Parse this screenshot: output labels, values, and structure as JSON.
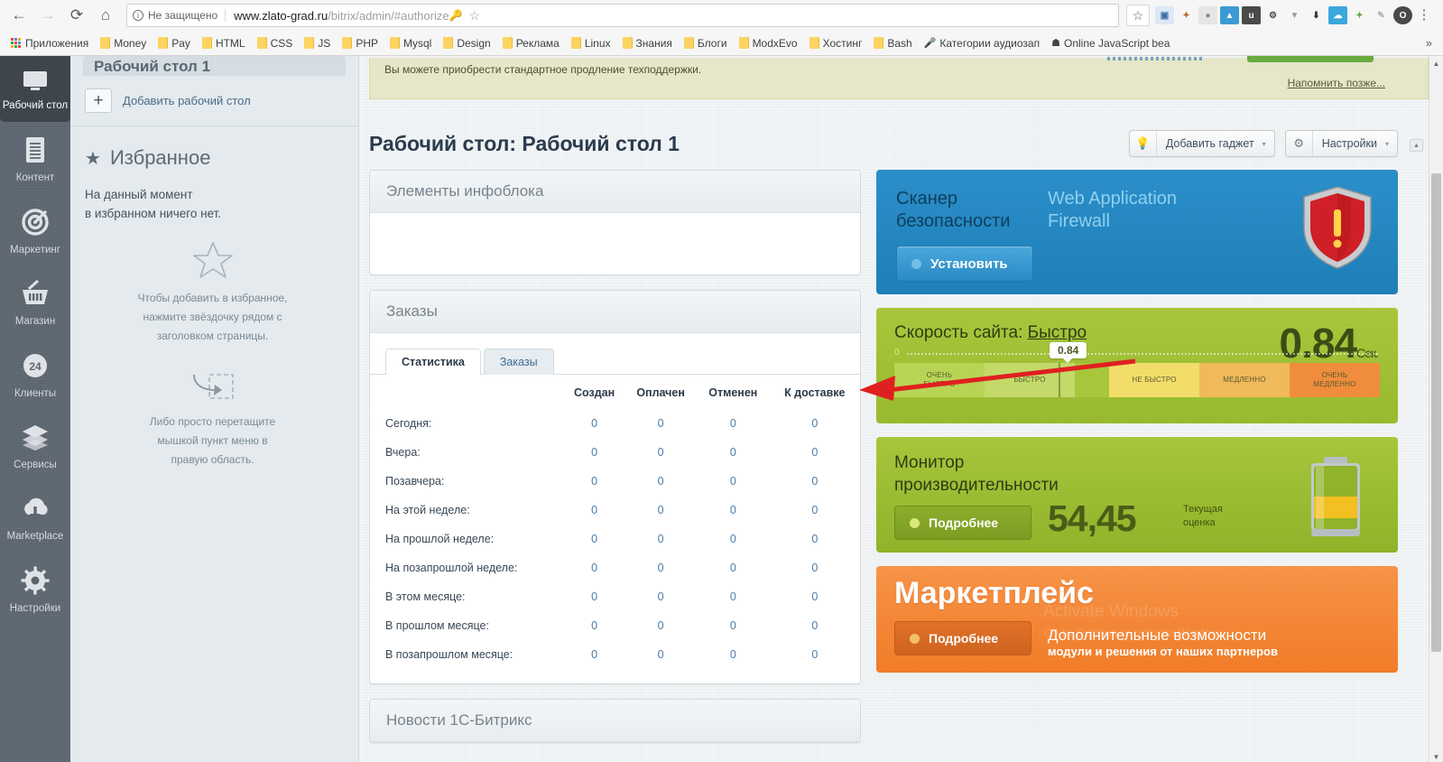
{
  "browser": {
    "nav": {
      "back": "←",
      "forward": "→",
      "reload": "⟳",
      "home": "⌂"
    },
    "security_label": "Не защищено",
    "url_host": "www.zlato-grad.ru",
    "url_path": "/bitrix/admin/#authorize",
    "bookmarks": [
      {
        "label": "Приложения",
        "icon": "apps-grid-icon"
      },
      {
        "label": "Money",
        "icon": "folder-icon"
      },
      {
        "label": "Pay",
        "icon": "folder-icon"
      },
      {
        "label": "HTML",
        "icon": "folder-icon"
      },
      {
        "label": "CSS",
        "icon": "folder-icon"
      },
      {
        "label": "JS",
        "icon": "folder-icon"
      },
      {
        "label": "PHP",
        "icon": "folder-icon"
      },
      {
        "label": "Mysql",
        "icon": "folder-icon"
      },
      {
        "label": "Design",
        "icon": "folder-icon"
      },
      {
        "label": "Реклама",
        "icon": "folder-icon"
      },
      {
        "label": "Linux",
        "icon": "folder-icon"
      },
      {
        "label": "Знания",
        "icon": "folder-icon"
      },
      {
        "label": "Блоги",
        "icon": "folder-icon"
      },
      {
        "label": "ModxEvo",
        "icon": "folder-icon"
      },
      {
        "label": "Хостинг",
        "icon": "folder-icon"
      },
      {
        "label": "Bash",
        "icon": "folder-icon"
      },
      {
        "label": "Категории аудиозап",
        "icon": "microphone-icon"
      },
      {
        "label": "Online JavaScript bea",
        "icon": "skull-icon"
      }
    ],
    "bookmarks_overflow": "»",
    "menu_dots": "⋮"
  },
  "left_nav": [
    {
      "label": "Рабочий стол",
      "icon": "desktop-icon",
      "active": true
    },
    {
      "label": "Контент",
      "icon": "document-icon",
      "active": false
    },
    {
      "label": "Маркетинг",
      "icon": "target-icon",
      "active": false
    },
    {
      "label": "Магазин",
      "icon": "basket-icon",
      "active": false
    },
    {
      "label": "Клиенты",
      "icon": "clients-24-icon",
      "active": false
    },
    {
      "label": "Сервисы",
      "icon": "layers-icon",
      "active": false
    },
    {
      "label": "Marketplace",
      "icon": "cloud-download-icon",
      "active": false
    },
    {
      "label": "Настройки",
      "icon": "gear-icon",
      "active": false
    }
  ],
  "favorites": {
    "desktop_tab_label": "Рабочий стол 1",
    "add_desktop_label": "Добавить рабочий стол",
    "add_desktop_plus": "+",
    "title": "Избранное",
    "star_glyph": "★",
    "empty_line1": "На данный момент",
    "empty_line2": "в избранном ничего нет.",
    "hint1": "Чтобы добавить в избранное,\nнажмите звёздочку рядом с\nзаголовком страницы.",
    "hint2": "Либо просто перетащите\nмышкой пункт меню в\nправую область."
  },
  "notice": {
    "text": "Вы можете приобрести стандартное продление техподдержки.",
    "later_link": "Напомнить позже..."
  },
  "header": {
    "title": "Рабочий стол: Рабочий стол 1",
    "add_gadget": "Добавить гаджет",
    "settings": "Настройки",
    "caret": "▾",
    "bulb_icon": "lightbulb-icon",
    "gear_icon": "gear-icon"
  },
  "panels": {
    "infoblock_title": "Элементы инфоблока",
    "orders_title": "Заказы",
    "news_title": "Новости 1С-Битрикс"
  },
  "orders": {
    "tabs": [
      {
        "label": "Статистика",
        "active": true
      },
      {
        "label": "Заказы",
        "active": false
      }
    ],
    "columns": [
      "",
      "Создан",
      "Оплачен",
      "Отменен",
      "К доставке"
    ],
    "rows": [
      {
        "label": "Сегодня:",
        "values": [
          "0",
          "0",
          "0",
          "0"
        ]
      },
      {
        "label": "Вчера:",
        "values": [
          "0",
          "0",
          "0",
          "0"
        ]
      },
      {
        "label": "Позавчера:",
        "values": [
          "0",
          "0",
          "0",
          "0"
        ]
      },
      {
        "label": "На этой неделе:",
        "values": [
          "0",
          "0",
          "0",
          "0"
        ]
      },
      {
        "label": "На прошлой неделе:",
        "values": [
          "0",
          "0",
          "0",
          "0"
        ]
      },
      {
        "label": "На позапрошлой неделе:",
        "values": [
          "0",
          "0",
          "0",
          "0"
        ]
      },
      {
        "label": "В этом месяце:",
        "values": [
          "0",
          "0",
          "0",
          "0"
        ]
      },
      {
        "label": "В прошлом месяце:",
        "values": [
          "0",
          "0",
          "0",
          "0"
        ]
      },
      {
        "label": "В позапрошлом месяце:",
        "values": [
          "0",
          "0",
          "0",
          "0"
        ]
      }
    ]
  },
  "widgets": {
    "waf": {
      "title": "Сканер\nбезопасности",
      "subtitle": "Web Application\nFirewall",
      "button": "Установить",
      "color": "#2b8fc9"
    },
    "speed": {
      "label": "Скорость сайта:",
      "rating": "Быстро",
      "value": "0.84",
      "unit": "Сек.",
      "bubble": "0.84",
      "zero": "0",
      "segments": [
        "ОЧЕНЬ\nБЫСТРО",
        "БЫСТРО",
        "",
        "НЕ БЫСТРО",
        "МЕДЛЕННО",
        "ОЧЕНЬ\nМЕДЛЕННО"
      ],
      "color": "#a8c63c"
    },
    "perf": {
      "title": "Монитор\nпроизводительности",
      "button": "Подробнее",
      "score": "54,45",
      "score_label": "Текущая\nоценка",
      "color": "#a6c63c"
    },
    "market": {
      "title": "Маркетплейс",
      "button": "Подробнее",
      "line1": "Дополнительные возможности",
      "line2": "модули и решения от наших партнеров",
      "watermark1": "Activate Windows",
      "watermark2": "Go to Settings to activate Windows.",
      "color": "#f07c28"
    }
  }
}
